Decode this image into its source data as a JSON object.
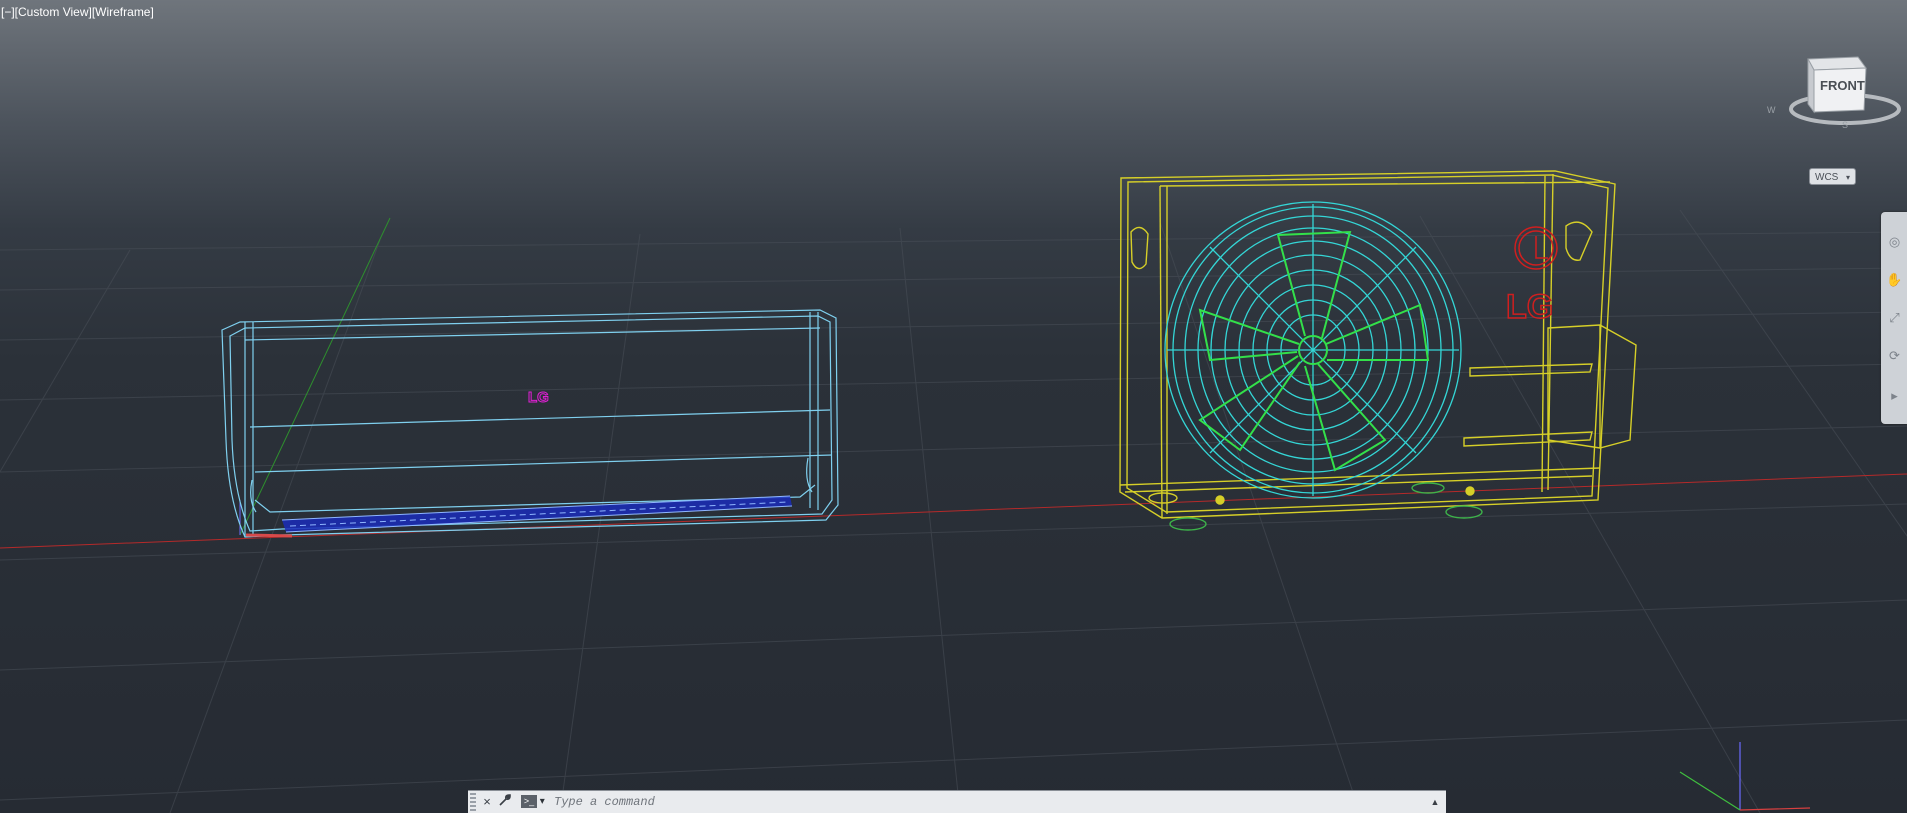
{
  "viewport": {
    "label": "[−][Custom View][Wireframe]"
  },
  "viewcube": {
    "face_label": "FRONT",
    "compass": {
      "west": "W",
      "south": "S"
    }
  },
  "ucs_menu": {
    "label": "WCS",
    "arrow": "▾"
  },
  "navigation_bar": {
    "tools": [
      "steering-wheel-icon",
      "pan-icon",
      "zoom-extents-icon",
      "orbit-icon",
      "showmotion-icon"
    ]
  },
  "scene": {
    "indoor_unit_logo": "LG",
    "outdoor_unit_logo": "LG",
    "colors": {
      "indoor_unit": "#7fd0ef",
      "indoor_vent": "#1a2bb8",
      "outdoor_unit": "#d6cf28",
      "fan_grill": "#34d6d6",
      "fan_blades": "#33e04a",
      "logo_indoor": "#e21fd6",
      "logo_outdoor": "#cf1f1f",
      "x_axis": "#b52a2a",
      "y_axis": "#2e8f2e",
      "z_axis": "#6a6aff"
    }
  },
  "command_line": {
    "placeholder": "Type a command",
    "close_icon": "×",
    "settings_icon": "wrench-icon",
    "prompt_icon": ">_",
    "history_icon": "▲"
  }
}
